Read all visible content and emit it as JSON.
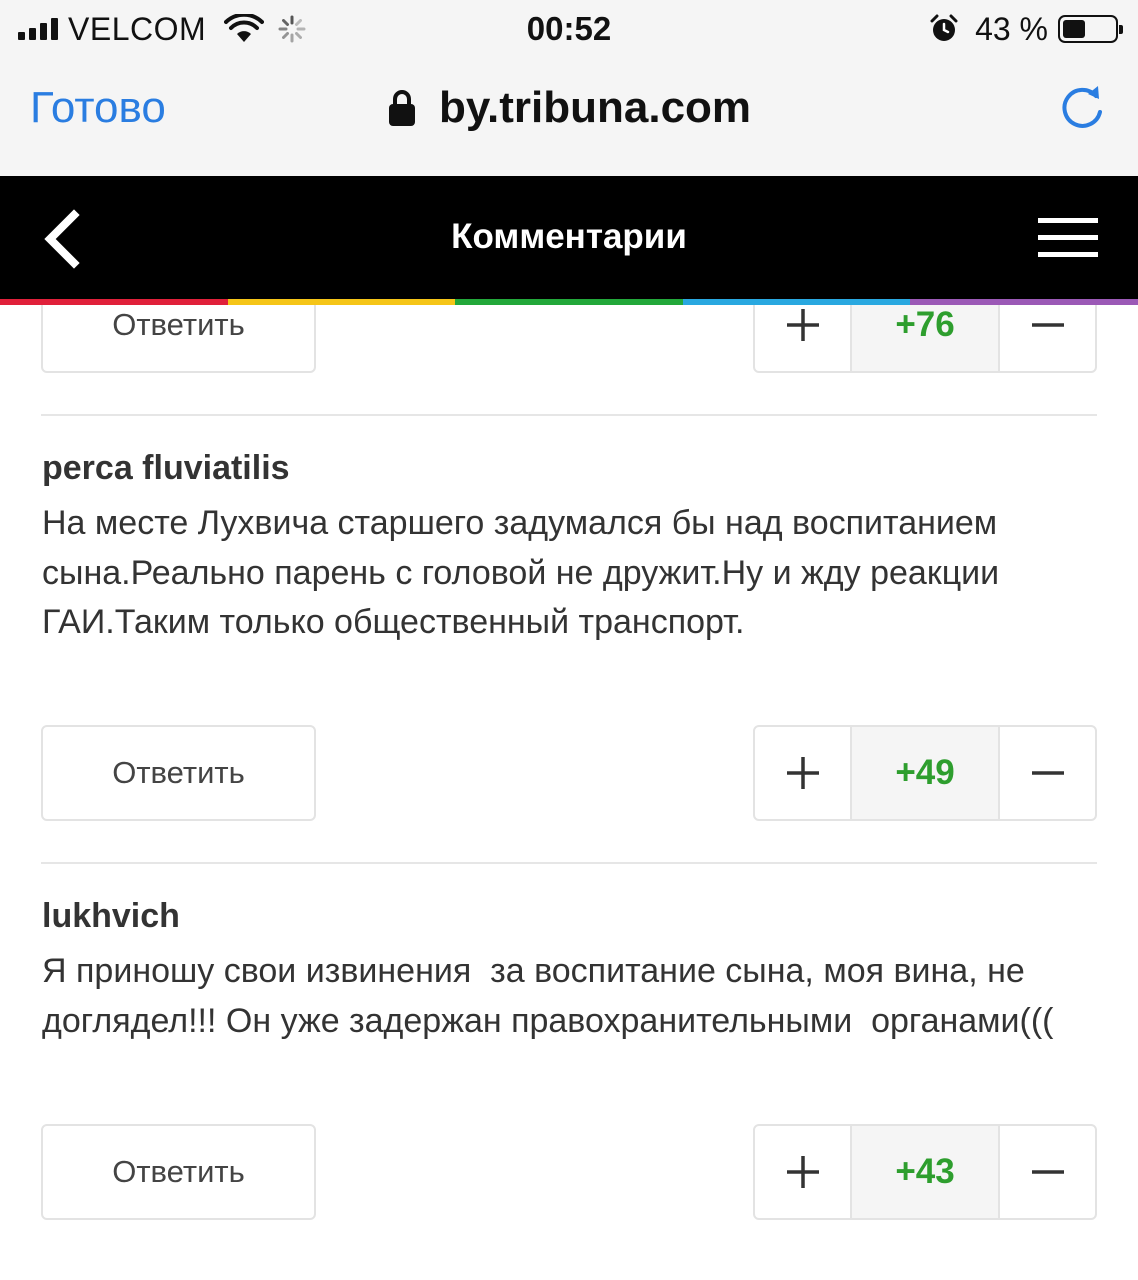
{
  "status_bar": {
    "carrier": "VELCOM",
    "time": "00:52",
    "battery_percent": "43 %",
    "battery_level": 0.43,
    "icons": [
      "signal-icon",
      "wifi-icon",
      "loading-icon",
      "alarm-icon",
      "battery-icon"
    ]
  },
  "browser": {
    "done_label": "Готово",
    "url": "by.tribuna.com",
    "icons": [
      "lock-icon",
      "reload-icon"
    ],
    "accent_color": "#2a7de1"
  },
  "header": {
    "title": "Комментарии",
    "icons": [
      "back-arrow-icon",
      "hamburger-menu-icon"
    ],
    "strip_colors": [
      "#e0203a",
      "#f5c518",
      "#22a83a",
      "#29a8e0",
      "#9b59b6"
    ]
  },
  "comments": [
    {
      "reply_label": "Ответить",
      "score": "+76"
    },
    {
      "author": "perca fluviatilis",
      "text": "На месте Лухвича старшего задумался бы над воспитанием сына.Реально парень с головой не дружит.Ну и жду реакции ГАИ.Таким только общественный транспорт.",
      "reply_label": "Ответить",
      "score": "+49"
    },
    {
      "author": "lukhvich",
      "text": "Я приношу свои извинения  за воспитание сына, моя вина, не доглядел!!! Он уже задержан правохранительными  органами(((",
      "reply_label": "Ответить",
      "score": "+43"
    }
  ],
  "score_color": "#2e9e2e"
}
